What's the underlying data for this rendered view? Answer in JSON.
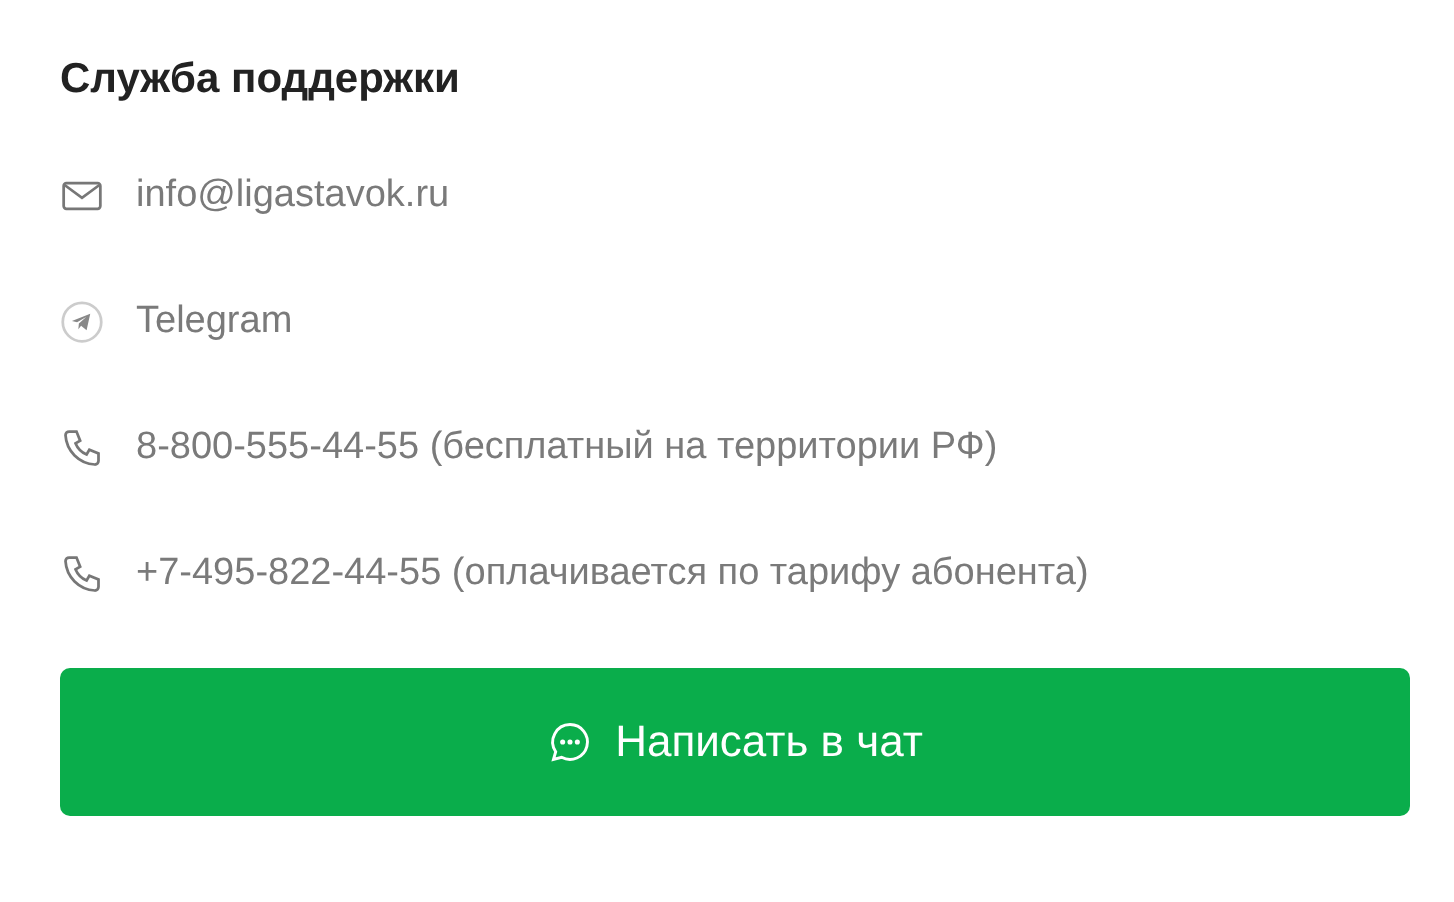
{
  "title": "Служба поддержки",
  "contacts": [
    {
      "kind": "email",
      "text": "info@ligastavok.ru"
    },
    {
      "kind": "telegram",
      "text": "Telegram"
    },
    {
      "kind": "phone",
      "text": "8-800-555-44-55 (бесплатный на территории РФ)"
    },
    {
      "kind": "phone",
      "text": "+7-495-822-44-55 (оплачивается по тарифу абонента)"
    }
  ],
  "chat_button": {
    "label": "Написать в чат"
  }
}
